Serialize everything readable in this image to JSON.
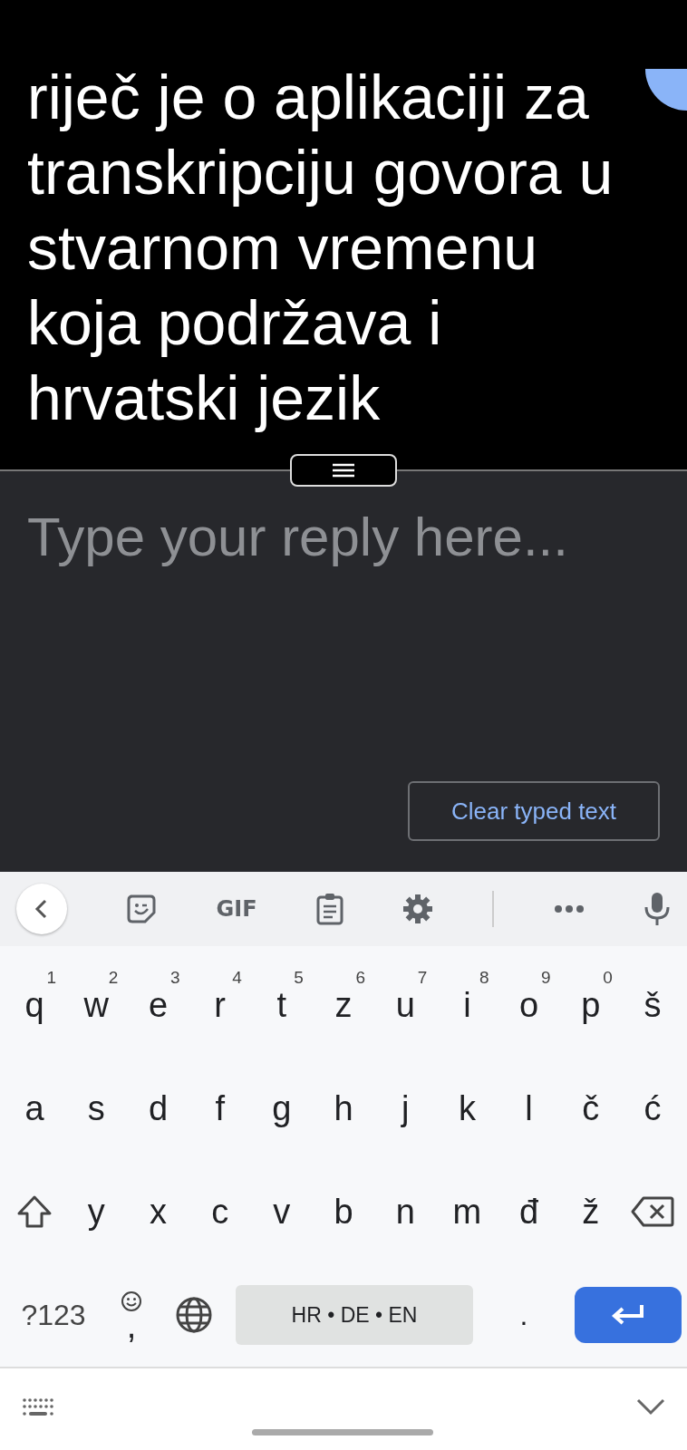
{
  "caption": {
    "text": "riječ je o aplikaciji za transkripciju govora u stvarnom vremenu koja podržava i hrvatski jezik"
  },
  "reply": {
    "placeholder": "Type your reply here..."
  },
  "clear_button": {
    "label": "Clear typed text"
  },
  "toolbar": [
    {
      "kind": "back"
    },
    {
      "kind": "sticker"
    },
    {
      "kind": "text",
      "label": "GIF"
    },
    {
      "kind": "clipboard"
    },
    {
      "kind": "settings"
    },
    {
      "kind": "divider"
    },
    {
      "kind": "more"
    },
    {
      "kind": "mic"
    }
  ],
  "keyboard": {
    "rows": [
      [
        {
          "kind": "letter",
          "label": "q",
          "hint": "1"
        },
        {
          "kind": "letter",
          "label": "w",
          "hint": "2"
        },
        {
          "kind": "letter",
          "label": "e",
          "hint": "3"
        },
        {
          "kind": "letter",
          "label": "r",
          "hint": "4"
        },
        {
          "kind": "letter",
          "label": "t",
          "hint": "5"
        },
        {
          "kind": "letter",
          "label": "z",
          "hint": "6"
        },
        {
          "kind": "letter",
          "label": "u",
          "hint": "7"
        },
        {
          "kind": "letter",
          "label": "i",
          "hint": "8"
        },
        {
          "kind": "letter",
          "label": "o",
          "hint": "9"
        },
        {
          "kind": "letter",
          "label": "p",
          "hint": "0"
        },
        {
          "kind": "letter",
          "label": "š"
        }
      ],
      [
        {
          "kind": "letter",
          "label": "a"
        },
        {
          "kind": "letter",
          "label": "s"
        },
        {
          "kind": "letter",
          "label": "d"
        },
        {
          "kind": "letter",
          "label": "f"
        },
        {
          "kind": "letter",
          "label": "g"
        },
        {
          "kind": "letter",
          "label": "h"
        },
        {
          "kind": "letter",
          "label": "j"
        },
        {
          "kind": "letter",
          "label": "k"
        },
        {
          "kind": "letter",
          "label": "l"
        },
        {
          "kind": "letter",
          "label": "č"
        },
        {
          "kind": "letter",
          "label": "ć"
        }
      ],
      [
        {
          "kind": "shift"
        },
        {
          "kind": "letter",
          "label": "y"
        },
        {
          "kind": "letter",
          "label": "x"
        },
        {
          "kind": "letter",
          "label": "c"
        },
        {
          "kind": "letter",
          "label": "v"
        },
        {
          "kind": "letter",
          "label": "b"
        },
        {
          "kind": "letter",
          "label": "n"
        },
        {
          "kind": "letter",
          "label": "m"
        },
        {
          "kind": "letter",
          "label": "đ"
        },
        {
          "kind": "letter",
          "label": "ž"
        },
        {
          "kind": "backspace"
        }
      ]
    ],
    "function_row": {
      "symbols": "?123",
      "comma": ",",
      "space": "HR • DE • EN",
      "period": "."
    }
  }
}
